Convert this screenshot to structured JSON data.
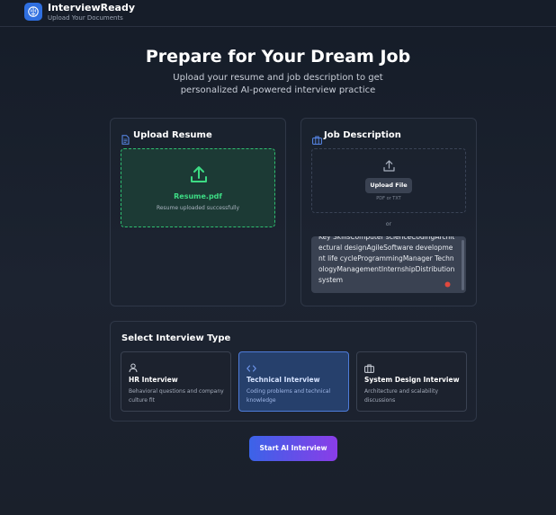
{
  "header": {
    "app_title": "InterviewReady",
    "app_subtitle": "Upload Your Documents"
  },
  "hero": {
    "title": "Prepare for Your Dream Job",
    "subtitle": "Upload your resume and job description to get personalized AI-powered interview practice"
  },
  "resume": {
    "title": "Upload Resume",
    "file_name": "Resume.pdf",
    "status": "Resume uploaded successfully"
  },
  "job": {
    "title": "Job Description",
    "upload_button": "Upload File",
    "file_hint": "PDF or TXT",
    "or_label": "or",
    "text_value": "Key SkillsComputer scienceCodingArchitectural designAgileSoftware development life cycleProgrammingManager TechnologyManagementInternshipDistribution system"
  },
  "interview": {
    "title": "Select Interview Type",
    "types": [
      {
        "name": "HR Interview",
        "description": "Behavioral questions and company culture fit",
        "icon": "person-icon"
      },
      {
        "name": "Technical Interview",
        "description": "Coding problems and technical knowledge",
        "icon": "code-icon"
      },
      {
        "name": "System Design Interview",
        "description": "Architecture and scalability discussions",
        "icon": "briefcase-icon"
      }
    ],
    "selected_index": 1
  },
  "actions": {
    "start_label": "Start AI Interview"
  },
  "colors": {
    "accent": "#3b63e8",
    "success": "#3ddc84",
    "selected_border": "#4d7bd9"
  }
}
